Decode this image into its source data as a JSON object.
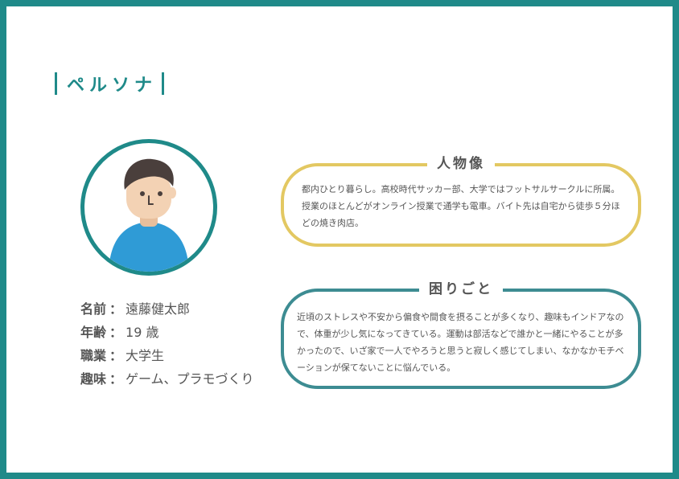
{
  "page": {
    "title": "ペルソナ"
  },
  "profile": {
    "rows": [
      {
        "label": "名前",
        "value": "遠藤健太郎"
      },
      {
        "label": "年齢",
        "value": "19 歳"
      },
      {
        "label": "職業",
        "value": "大学生"
      },
      {
        "label": "趣味",
        "value": "ゲーム、プラモづくり"
      }
    ],
    "separator": "："
  },
  "persona_card": {
    "heading": "人物像",
    "body": "都内ひとり暮らし。高校時代サッカー部、大学ではフットサルサークルに所属。授業のほとんどがオンライン授業で通学も電車。バイト先は自宅から徒歩５分ほどの焼き肉店。"
  },
  "problem_card": {
    "heading": "困りごと",
    "body": "近頃のストレスや不安から偏食や間食を摂ることが多くなり、趣味もインドアなので、体重が少し気になってきている。運動は部活などで誰かと一緒にやることが多かったので、いざ家で一人でやろうと思うと寂しく感じてしまい、なかなかモチベーションが保てないことに悩んでいる。"
  },
  "colors": {
    "frame": "#1f8a89",
    "persona_border": "#e3c862",
    "problem_border": "#3d8c92",
    "text": "#555555",
    "shirt": "#2f9bd6",
    "skin": "#f3d2b4",
    "hair": "#4a3f3c"
  },
  "icons": {
    "avatar": "person-avatar-icon"
  }
}
